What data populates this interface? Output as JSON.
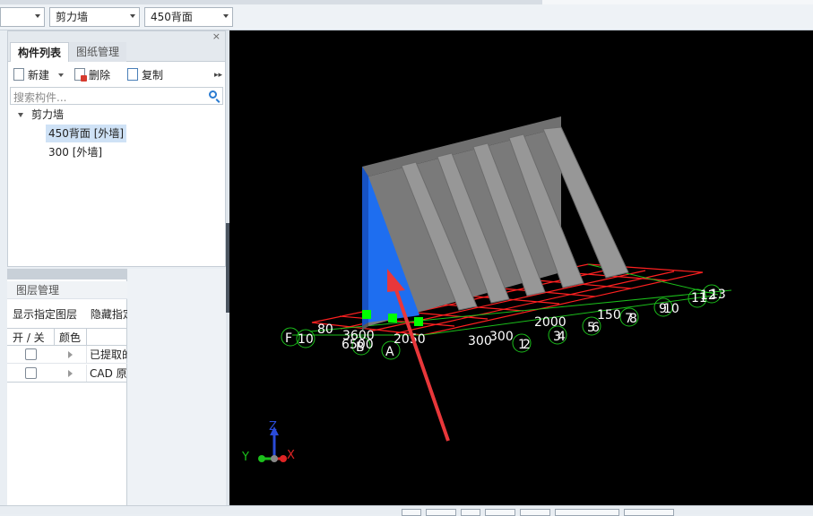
{
  "topbar": {
    "dropdown_type": "剪力墙",
    "dropdown_item": "450背面"
  },
  "panel": {
    "close_glyph": "×",
    "tabs": [
      {
        "label": "构件列表"
      },
      {
        "label": "图纸管理"
      }
    ],
    "toolbar": {
      "new_label": "新建",
      "delete_label": "删除",
      "copy_label": "复制",
      "more_glyph": "▸▸"
    },
    "search": {
      "placeholder": "搜索构件..."
    },
    "tree": {
      "root": "剪力墙",
      "children": [
        {
          "label": "450背面 [外墙]",
          "selected": true
        },
        {
          "label": "300 [外墙]",
          "selected": false
        }
      ]
    }
  },
  "layers": {
    "title": "图层管理",
    "tools": [
      "显示指定图层",
      "隐藏指定"
    ],
    "columns": [
      "开 / 关",
      "颜色"
    ],
    "rows": [
      {
        "label": "已提取的",
        "checked": false
      },
      {
        "label": "CAD 原",
        "checked": false
      }
    ]
  },
  "viewport": {
    "background": "#000000",
    "wall_color": "#8c8c8c",
    "selected_face_color": "#1e6ef0",
    "grid_color": "#ff2020",
    "axis_color": "#1bbf1b",
    "arrow_color": "#e8373a",
    "grip_color": "#00ff00",
    "axis_labels": {
      "x": "X",
      "y": "Y",
      "z": "Z"
    },
    "grid_labels": [
      "F",
      "10",
      "80",
      "3600",
      "2050",
      "300",
      "300",
      "2000",
      "B",
      "A",
      "1",
      "2",
      "3",
      "4",
      "5",
      "6",
      "150",
      "7",
      "8",
      "9",
      "10",
      "11",
      "12",
      "13"
    ],
    "grid_label_note": [
      "6500"
    ]
  }
}
